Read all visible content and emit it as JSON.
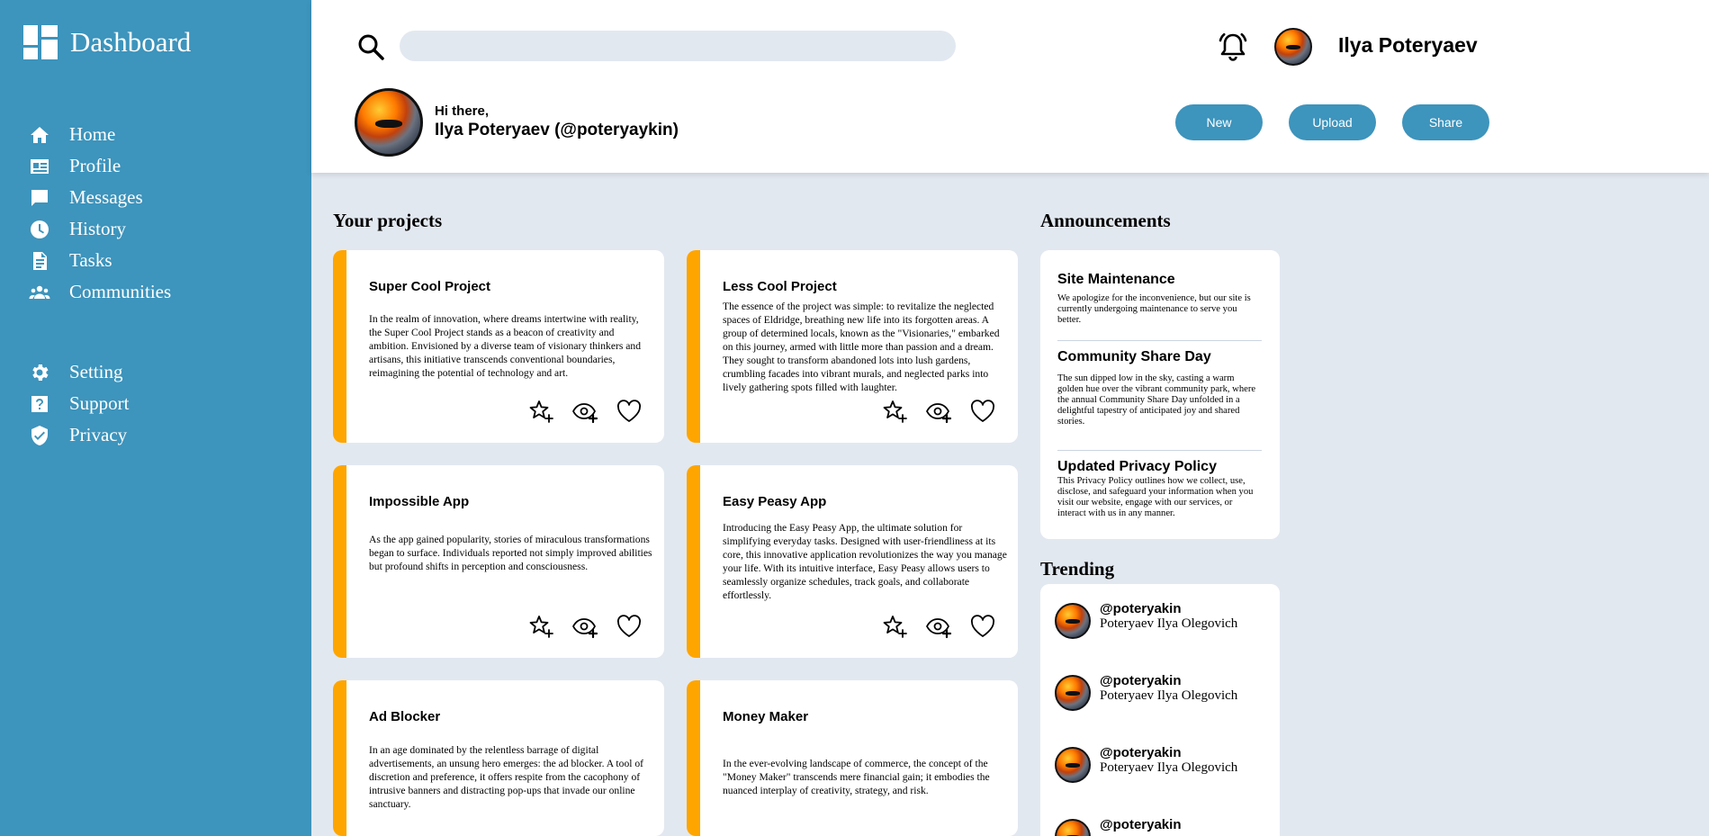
{
  "sidebar": {
    "brand": "Dashboard",
    "brand_icon": "dashboard-icon",
    "main_items": [
      {
        "label": "Home",
        "icon": "home-icon"
      },
      {
        "label": "Profile",
        "icon": "profile-card-icon"
      },
      {
        "label": "Messages",
        "icon": "message-icon"
      },
      {
        "label": "History",
        "icon": "clock-icon"
      },
      {
        "label": "Tasks",
        "icon": "document-icon"
      },
      {
        "label": "Communities",
        "icon": "group-icon"
      }
    ],
    "secondary_items": [
      {
        "label": "Setting",
        "icon": "gear-icon"
      },
      {
        "label": "Support",
        "icon": "help-icon"
      },
      {
        "label": "Privacy",
        "icon": "shield-check-icon"
      }
    ]
  },
  "header": {
    "search_value": "",
    "user_name": "Ilya Poteryaev",
    "greeting_small": "Hi there,",
    "greeting_big": "Ilya Poteryaev (@poteryaykin)",
    "buttons": {
      "new": "New",
      "upload": "Upload",
      "share": "Share"
    }
  },
  "sections": {
    "projects": "Your projects",
    "announcements": "Announcements",
    "trending": "Trending"
  },
  "projects": [
    {
      "title": "Super Cool Project",
      "desc": "In the realm of innovation, where dreams intertwine with reality, the Super Cool Project stands as a beacon of creativity and ambition. Envisioned by a diverse team of visionary thinkers and artisans, this initiative transcends conventional boundaries, reimagining the potential of technology and art."
    },
    {
      "title": "Less Cool Project",
      "desc": "The essence of the project was simple: to revitalize the neglected spaces of Eldridge, breathing new life into its forgotten areas. A group of determined locals, known as the \"Visionaries,\" embarked on this journey, armed with little more than passion and a dream. They sought to transform abandoned lots into lush gardens, crumbling facades into vibrant murals, and neglected parks into lively gathering spots filled with laughter."
    },
    {
      "title": "Impossible App",
      "desc": "As the app gained popularity, stories of miraculous transformations began to surface. Individuals reported not simply improved abilities but profound shifts in perception and consciousness."
    },
    {
      "title": "Easy Peasy App",
      "desc": "Introducing the Easy Peasy App, the ultimate solution for simplifying everyday tasks. Designed with user-friendliness at its core, this innovative application revolutionizes the way you manage your life. With its intuitive interface, Easy Peasy allows users to seamlessly organize schedules, track goals, and collaborate effortlessly."
    },
    {
      "title": "Ad Blocker",
      "desc": "In an age dominated by the relentless barrage of digital advertisements, an unsung hero emerges: the ad blocker. A tool of discretion and preference, it offers respite from the cacophony of intrusive banners and distracting pop-ups that invade our online sanctuary."
    },
    {
      "title": "Money Maker",
      "desc": "In the ever-evolving landscape of commerce, the concept of the \"Money Maker\" transcends mere financial gain; it embodies the nuanced interplay of creativity, strategy, and risk."
    }
  ],
  "announcements": [
    {
      "title": "Site Maintenance",
      "text": "We apologize for the inconvenience, but our site is currently undergoing maintenance to serve you better."
    },
    {
      "title": "Community Share Day",
      "text": "The sun dipped low in the sky, casting a warm golden hue over the vibrant community park, where the annual Community Share Day unfolded in a delightful tapestry of anticipated joy and shared stories."
    },
    {
      "title": "Updated Privacy Policy",
      "text": "This Privacy Policy outlines how we collect, use, disclose, and safeguard your information when you visit our website, engage with our services, or interact with us in any manner."
    }
  ],
  "trending": [
    {
      "handle": "@poteryakin",
      "name": "Poteryaev Ilya Olegovich"
    },
    {
      "handle": "@poteryakin",
      "name": "Poteryaev Ilya Olegovich"
    },
    {
      "handle": "@poteryakin",
      "name": "Poteryaev Ilya Olegovich"
    },
    {
      "handle": "@poteryakin",
      "name": ""
    }
  ],
  "colors": {
    "sidebar": "#3d94bc",
    "accent": "#fea500",
    "background": "#e2e8f0"
  }
}
